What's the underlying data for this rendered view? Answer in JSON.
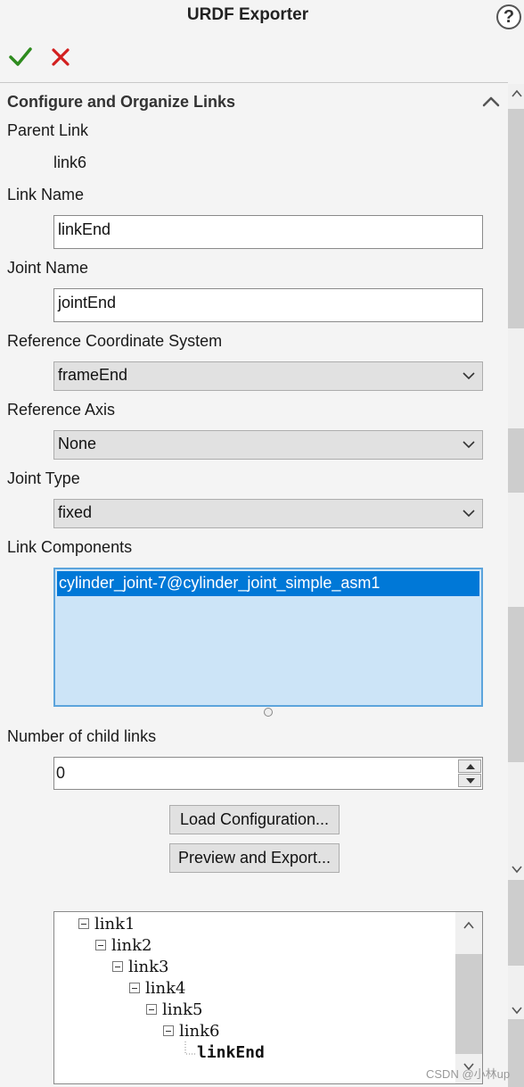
{
  "window": {
    "title": "URDF Exporter"
  },
  "toolbar": {
    "help_label": "?",
    "ok_icon": "check-icon",
    "cancel_icon": "close-icon",
    "ok_color": "#2e8b1e",
    "cancel_color": "#d21f1f"
  },
  "section": {
    "title": "Configure and Organize Links"
  },
  "parent_link": {
    "label": "Parent Link",
    "value": "link6"
  },
  "link_name": {
    "label": "Link Name",
    "value": "linkEnd"
  },
  "joint_name": {
    "label": "Joint Name",
    "value": "jointEnd"
  },
  "ref_coord": {
    "label": "Reference Coordinate System",
    "selected": "frameEnd"
  },
  "ref_axis": {
    "label": "Reference Axis",
    "selected": "None"
  },
  "joint_type": {
    "label": "Joint Type",
    "selected": "fixed"
  },
  "link_components": {
    "label": "Link Components",
    "items": [
      "cylinder_joint-7@cylinder_joint_simple_asm1"
    ]
  },
  "child_links": {
    "label": "Number of child links",
    "value": "0"
  },
  "buttons": {
    "load": "Load Configuration...",
    "preview": "Preview and Export..."
  },
  "tree": {
    "nodes": [
      {
        "label": "link1"
      },
      {
        "label": "link2"
      },
      {
        "label": "link3"
      },
      {
        "label": "link4"
      },
      {
        "label": "link5"
      },
      {
        "label": "link6"
      },
      {
        "label": "linkEnd"
      }
    ]
  },
  "watermark": "CSDN @小林up"
}
